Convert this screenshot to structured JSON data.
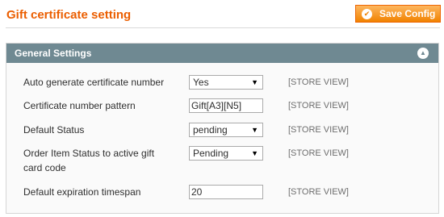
{
  "header": {
    "title": "Gift certificate setting",
    "save_label": "Save Config"
  },
  "section": {
    "title": "General Settings"
  },
  "fields": [
    {
      "label": "Auto generate certificate number",
      "type": "select",
      "value": "Yes",
      "scope": "[STORE VIEW]"
    },
    {
      "label": "Certificate number pattern",
      "type": "text",
      "value": "Gift[A3][N5]",
      "scope": "[STORE VIEW]"
    },
    {
      "label": "Default Status",
      "type": "select",
      "value": "pending",
      "scope": "[STORE VIEW]"
    },
    {
      "label": "Order Item Status to active gift card code",
      "type": "select",
      "value": "Pending",
      "scope": "[STORE VIEW]"
    },
    {
      "label": "Default expiration timespan",
      "type": "text",
      "value": "20",
      "scope": "[STORE VIEW]"
    }
  ],
  "colors": {
    "title": "#eb5e00",
    "button": "#f18200",
    "panel_header": "#6f8992"
  },
  "icons": {
    "save": "check-circle-icon",
    "collapse": "chevron-up-circle-icon"
  }
}
